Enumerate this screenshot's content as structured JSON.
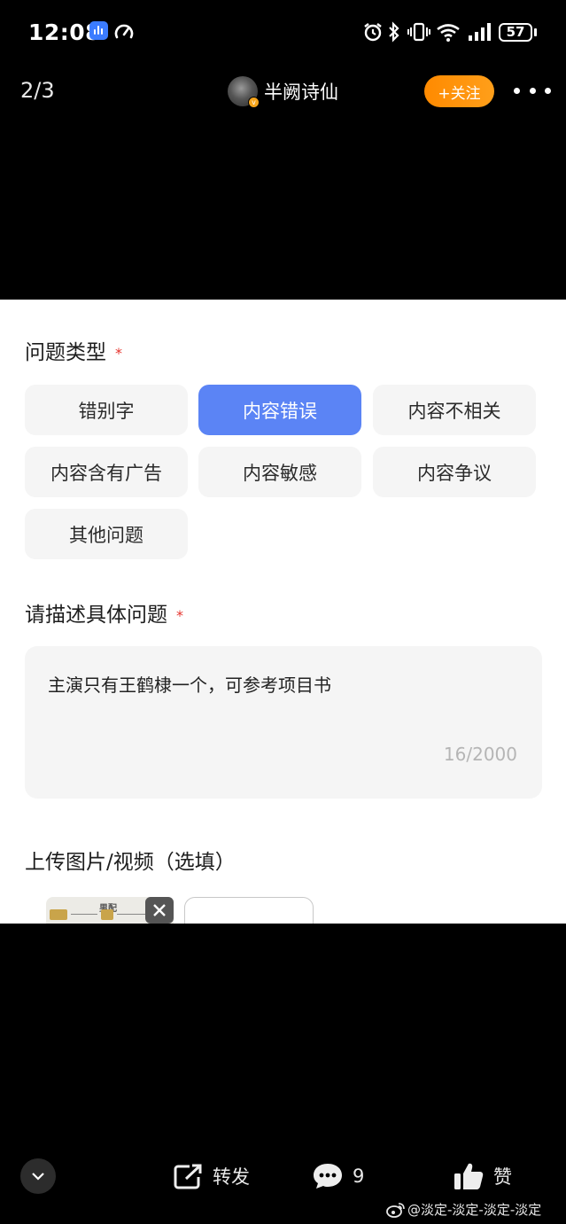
{
  "status_bar": {
    "time": "12:08",
    "battery": "57",
    "icons": [
      "voice-assistant-icon",
      "speedometer-icon",
      "alarm-icon",
      "bluetooth-icon",
      "vibrate-icon",
      "wifi-icon",
      "signal-icon",
      "battery-icon"
    ]
  },
  "top_nav": {
    "page_counter": "2/3",
    "author_name": "半阙诗仙",
    "follow_label": "+关注"
  },
  "form": {
    "issue_type_title": "问题类型",
    "required_mark": "*",
    "issue_types": [
      {
        "label": "错别字",
        "selected": false
      },
      {
        "label": "内容错误",
        "selected": true
      },
      {
        "label": "内容不相关",
        "selected": false
      },
      {
        "label": "内容含有广告",
        "selected": false
      },
      {
        "label": "内容敏感",
        "selected": false
      },
      {
        "label": "内容争议",
        "selected": false
      },
      {
        "label": "其他问题",
        "selected": false
      }
    ],
    "describe_title": "请描述具体问题",
    "describe_value": "主演只有王鹤棣一个，可参考项目书",
    "char_count": "16/2000",
    "upload_title": "上传图片/视频（选填）",
    "thumb_title": "男配"
  },
  "bottom_bar": {
    "forward_label": "转发",
    "comment_count": "9",
    "like_label": "赞"
  },
  "watermark": "@淡定-淡定-淡定-淡定",
  "colors": {
    "accent_blue": "#5b84f5",
    "follow_orange": "#ff8a00",
    "required_red": "#e5342e"
  }
}
